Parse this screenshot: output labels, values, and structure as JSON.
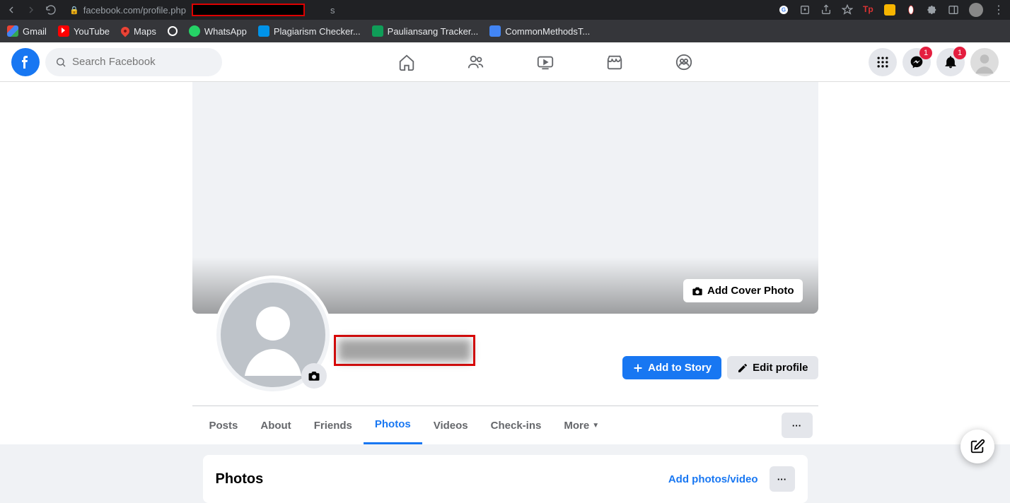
{
  "browser": {
    "url": "facebook.com/profile.php",
    "url_suffix": "s",
    "bookmarks": [
      {
        "label": "Gmail"
      },
      {
        "label": "YouTube"
      },
      {
        "label": "Maps"
      },
      {
        "label": ""
      },
      {
        "label": "WhatsApp"
      },
      {
        "label": "Plagiarism Checker..."
      },
      {
        "label": "Pauliansang Tracker..."
      },
      {
        "label": "CommonMethodsT..."
      }
    ]
  },
  "header": {
    "search_placeholder": "Search Facebook",
    "messenger_badge": "1",
    "notification_badge": "1"
  },
  "profile": {
    "cover_btn": "Add Cover Photo",
    "add_story": "Add to Story",
    "edit_profile": "Edit profile",
    "tabs": [
      "Posts",
      "About",
      "Friends",
      "Photos",
      "Videos",
      "Check-ins",
      "More"
    ],
    "active_tab": "Photos",
    "more_dots": "···"
  },
  "photos": {
    "title": "Photos",
    "add_link": "Add photos/video",
    "more": "···"
  }
}
